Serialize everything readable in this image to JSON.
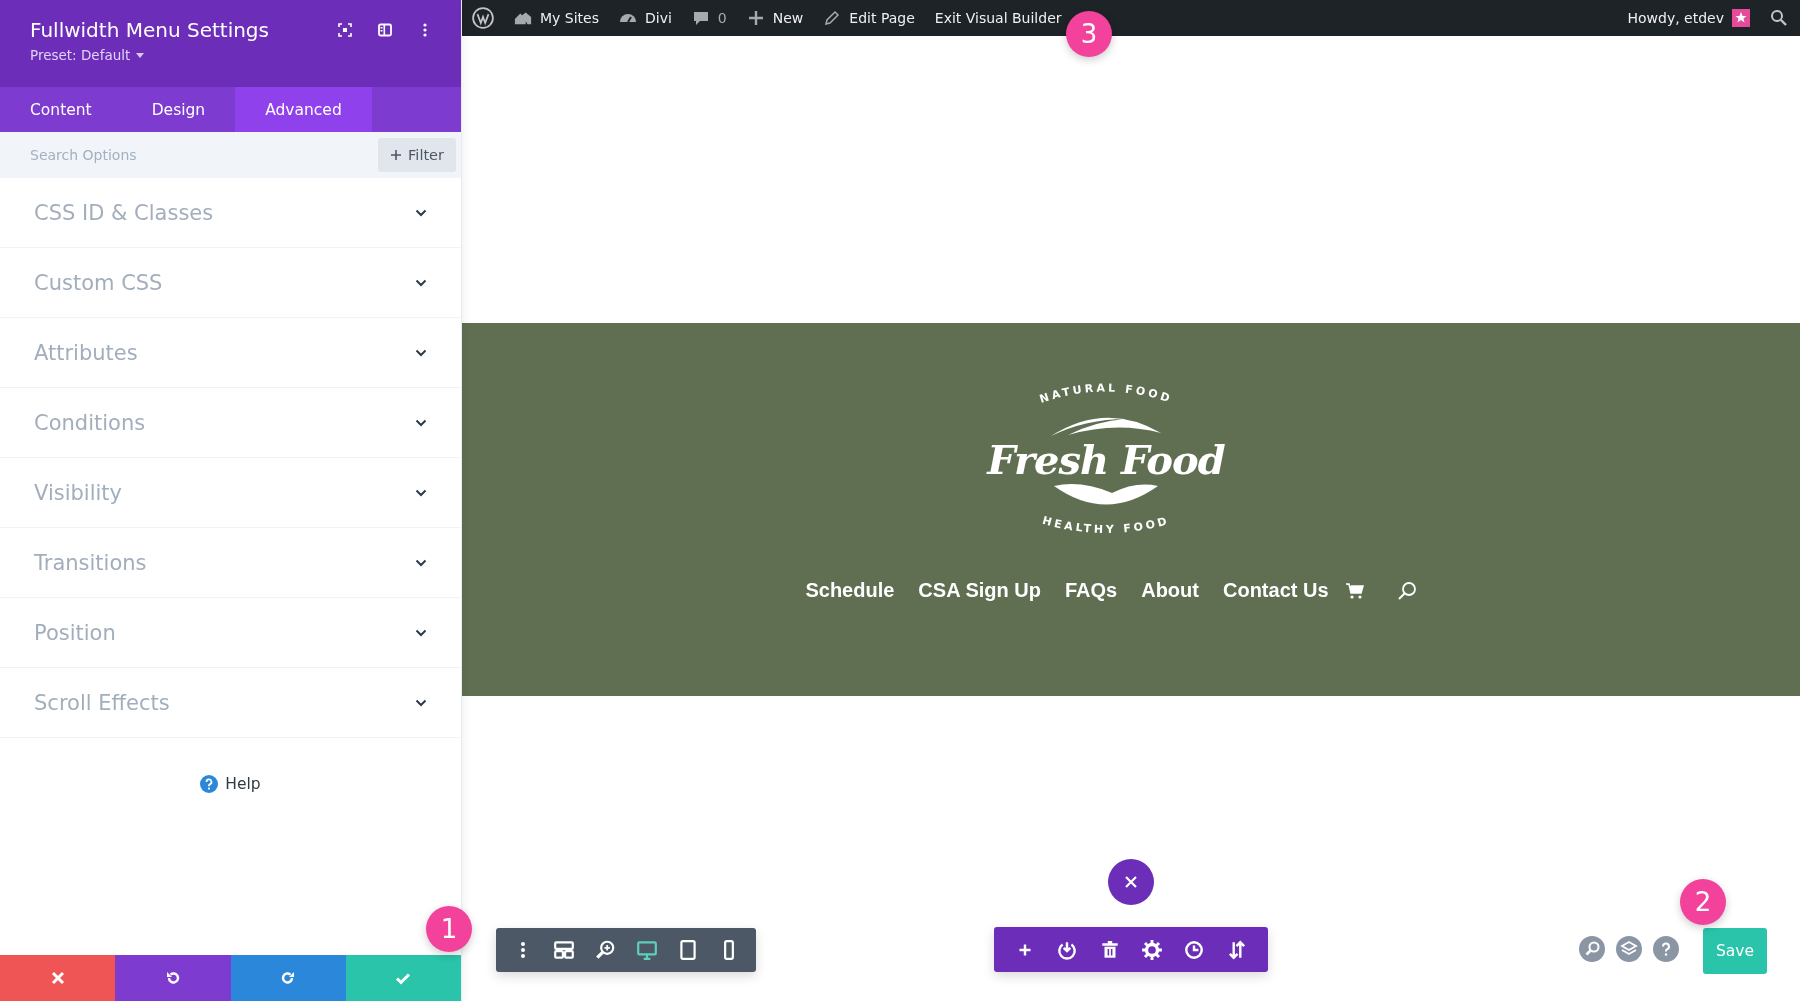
{
  "panel": {
    "title": "Fullwidth Menu Settings",
    "preset": "Preset: Default",
    "tabs": [
      {
        "label": "Content",
        "selected": false
      },
      {
        "label": "Design",
        "selected": false
      },
      {
        "label": "Advanced",
        "selected": true
      }
    ],
    "search": {
      "placeholder": "Search Options"
    },
    "filter_button": "Filter",
    "sections": [
      {
        "label": "CSS ID & Classes",
        "expanded": false
      },
      {
        "label": "Custom CSS",
        "expanded": false
      },
      {
        "label": "Attributes",
        "expanded": false
      },
      {
        "label": "Conditions",
        "expanded": false
      },
      {
        "label": "Visibility",
        "expanded": false
      },
      {
        "label": "Transitions",
        "expanded": false
      },
      {
        "label": "Position",
        "expanded": false
      },
      {
        "label": "Scroll Effects",
        "expanded": false
      }
    ],
    "help": "Help",
    "footer_actions": [
      {
        "kind": "discard"
      },
      {
        "kind": "undo"
      },
      {
        "kind": "redo"
      },
      {
        "kind": "save"
      }
    ]
  },
  "admin_bar": {
    "items": [
      {
        "kind": "my-sites",
        "label": "My Sites"
      },
      {
        "kind": "divi",
        "label": "Divi"
      },
      {
        "kind": "comments",
        "label": "0"
      },
      {
        "kind": "new",
        "label": "New"
      },
      {
        "kind": "edit",
        "label": "Edit Page"
      },
      {
        "kind": "exit",
        "label": "Exit Visual Builder"
      }
    ],
    "greeting": "Howdy, etdev"
  },
  "site": {
    "logo": {
      "top_text": "NATURAL FOOD",
      "title": "Fresh Food",
      "bottom_text": "HEALTHY FOOD"
    },
    "menu": [
      "Schedule",
      "CSA Sign Up",
      "FAQs",
      "About",
      "Contact Us"
    ]
  },
  "view_toolbar": [
    {
      "kind": "menu",
      "selected": false
    },
    {
      "kind": "wireframe",
      "selected": false
    },
    {
      "kind": "zoom",
      "selected": false
    },
    {
      "kind": "desktop",
      "selected": true
    },
    {
      "kind": "tablet",
      "selected": false
    },
    {
      "kind": "phone",
      "selected": false
    }
  ],
  "module_toolbar": [
    {
      "kind": "add"
    },
    {
      "kind": "load"
    },
    {
      "kind": "delete"
    },
    {
      "kind": "settings"
    },
    {
      "kind": "history"
    },
    {
      "kind": "portability"
    }
  ],
  "page_tools": [
    {
      "kind": "search"
    },
    {
      "kind": "layers"
    },
    {
      "kind": "help"
    }
  ],
  "save_button": "Save",
  "badges": [
    {
      "kind": "footer",
      "label": "1"
    },
    {
      "kind": "save",
      "label": "2"
    },
    {
      "kind": "exit",
      "label": "3"
    }
  ]
}
